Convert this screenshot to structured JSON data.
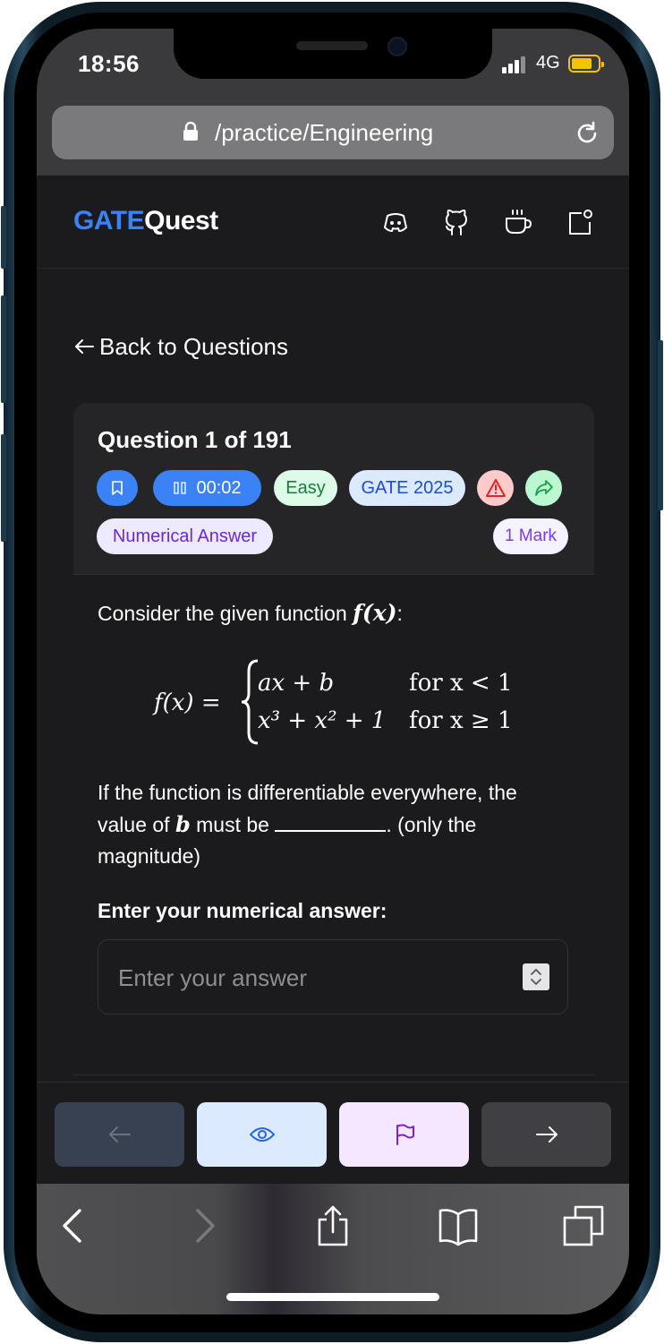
{
  "status_bar": {
    "time": "18:56",
    "network": "4G"
  },
  "browser": {
    "url": "/practice/Engineering"
  },
  "header": {
    "logo_part1": "GATE",
    "logo_part2": "Quest",
    "icons": [
      "discord-icon",
      "github-icon",
      "coffee-icon",
      "notification-icon"
    ]
  },
  "nav": {
    "back_label": "Back to Questions"
  },
  "question": {
    "title": "Question 1 of 191",
    "timer": "00:02",
    "difficulty": "Easy",
    "exam": "GATE 2025",
    "type": "Numerical Answer",
    "marks": "1 Mark",
    "intro": "Consider the given function",
    "intro_math": "f(x)",
    "intro_suffix": ":",
    "equation": {
      "lhs": "f(x) =",
      "case1_expr": "ax + b",
      "case1_cond": "for x < 1",
      "case2_expr": "x³ + x² + 1",
      "case2_cond": "for x ≥ 1"
    },
    "body_part1": "If the function is differentiable everywhere, the value of",
    "body_var": "b",
    "body_part2": "must be",
    "body_part3": ". (only the magnitude)"
  },
  "answer": {
    "label": "Enter your numerical answer:",
    "placeholder": "Enter your answer"
  },
  "colors": {
    "accent": "#3b82f6",
    "background": "#1b1b1d",
    "easy_chip": "#dcfce7",
    "exam_chip": "#dbeafe",
    "type_chip": "#ede9fe"
  }
}
